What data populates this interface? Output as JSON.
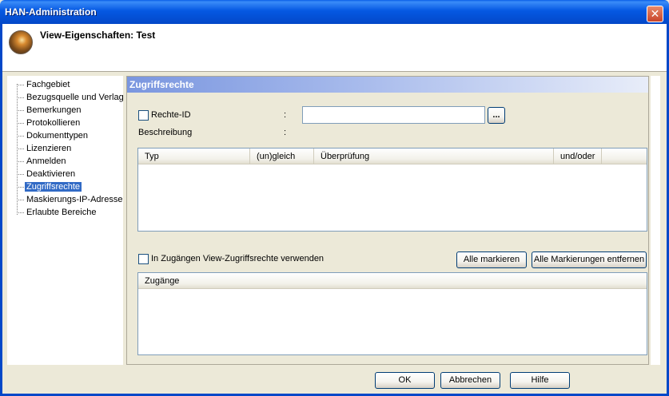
{
  "window": {
    "title": "HAN-Administration",
    "close_glyph": "✕"
  },
  "header": {
    "title": "View-Eigenschaften: Test",
    "icon": "globe-icon"
  },
  "tree": {
    "items": [
      "Fachgebiet",
      "Bezugsquelle und Verlag",
      "Bemerkungen",
      "Protokollieren",
      "Dokumenttypen",
      "Lizenzieren",
      "Anmelden",
      "Deaktivieren",
      "Zugriffsrechte",
      "Maskierungs-IP-Adresse",
      "Erlaubte Bereiche"
    ],
    "selected": "Zugriffsrechte"
  },
  "panel": {
    "title": "Zugriffsrechte",
    "rechte_id_label": "Rechte-ID",
    "rechte_id_value": "",
    "browse_label": "...",
    "beschreibung_label": "Beschreibung",
    "colon": ":",
    "rights_table": {
      "columns": [
        "Typ",
        "(un)gleich",
        "Überprüfung",
        "und/oder"
      ]
    },
    "use_view_rights_label": "In Zugängen View-Zugriffsrechte verwenden",
    "mark_all_label": "Alle markieren",
    "unmark_all_label": "Alle Markierungen entfernen",
    "access_table": {
      "columns": [
        "Zugänge"
      ]
    }
  },
  "footer": {
    "ok_label": "OK",
    "cancel_label": "Abbrechen",
    "help_label": "Hilfe"
  }
}
